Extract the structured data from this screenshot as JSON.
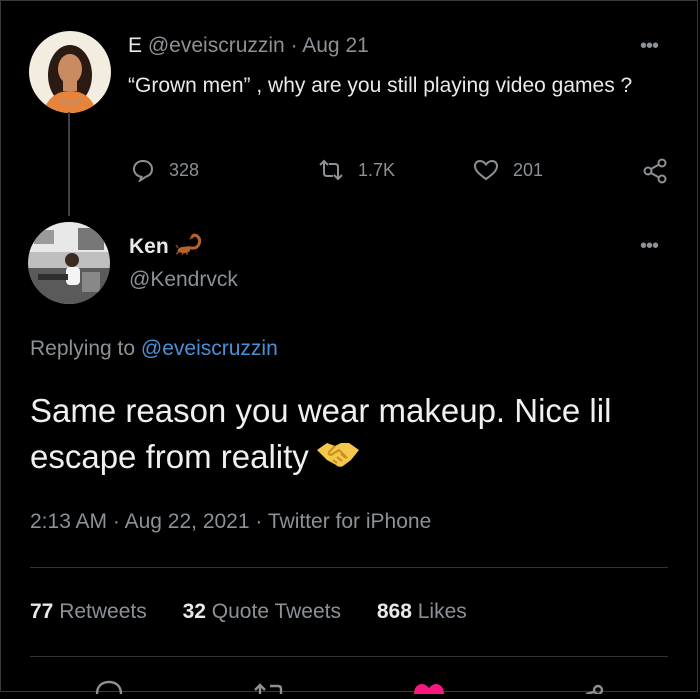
{
  "original_tweet": {
    "display_name": "E",
    "handle": "@eveiscruzzin",
    "date": "Aug 21",
    "text": "“Grown men” , why are you still playing video games ?",
    "replies": "328",
    "retweets": "1.7K",
    "likes": "201"
  },
  "reply_tweet": {
    "display_name": "Ken",
    "handle": "@Kendrvck",
    "replying_prefix": "Replying to",
    "replying_to": "@eveiscruzzin",
    "text": "Same reason you wear makeup. Nice lil escape from reality",
    "time": "2:13 AM",
    "date": "Aug 22, 2021",
    "source": "Twitter for iPhone",
    "separator": "·"
  },
  "stats": {
    "retweets_count": "77",
    "retweets_label": "Retweets",
    "quotes_count": "32",
    "quotes_label": "Quote Tweets",
    "likes_count": "868",
    "likes_label": "Likes"
  },
  "icons": {
    "reply": "speech-bubble-icon",
    "retweet": "retweet-arrows-icon",
    "like": "heart-icon",
    "share": "share-nodes-icon",
    "more": "more-dots-icon",
    "name_badge": "scorpion-emoji",
    "text_emoji": "handshake-emoji"
  },
  "colors": {
    "background": "#000000",
    "text": "#e7e9ea",
    "muted": "#8b9196",
    "link": "#4a90d9",
    "like_active": "#f91880"
  }
}
